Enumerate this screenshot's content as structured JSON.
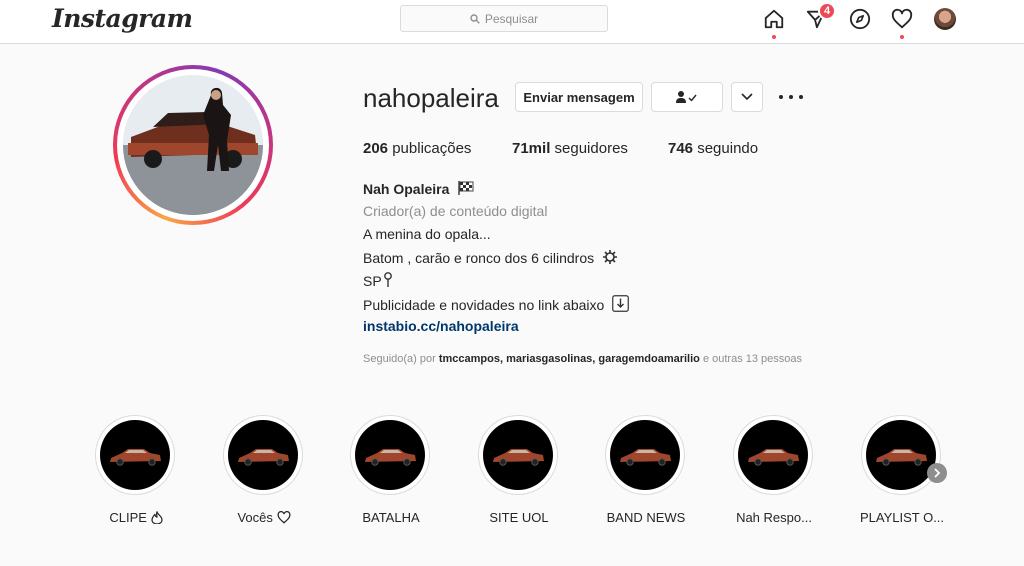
{
  "nav": {
    "logo": "Instagram",
    "search_placeholder": "Pesquisar",
    "notification_count": "4"
  },
  "profile": {
    "username": "nahopaleira",
    "message_button": "Enviar mensagem",
    "stats": {
      "posts_count": "206",
      "posts_label": "publicações",
      "followers_count": "71mil",
      "followers_label": "seguidores",
      "following_count": "746",
      "following_label": "seguindo"
    },
    "bio": {
      "name": "Nah Opaleira",
      "category": "Criador(a) de conteúdo digital",
      "line1": "A menina do opala...",
      "line2": "Batom , carão e ronco dos 6 cilindros",
      "line3": "SP",
      "line4": "Publicidade e novidades no link abaixo",
      "link": "instabio.cc/nahopaleira"
    },
    "followed_by": {
      "prefix": "Seguido(a) por",
      "users": "tmccampos, mariasgasolinas, garagemdoamarilio",
      "suffix": "e outras 13 pessoas"
    }
  },
  "highlights": [
    {
      "label": "CLIPE"
    },
    {
      "label": "Vocês"
    },
    {
      "label": "BATALHA"
    },
    {
      "label": "SITE UOL"
    },
    {
      "label": "BAND NEWS"
    },
    {
      "label": "Nah Respo..."
    },
    {
      "label": "PLAYLIST O..."
    }
  ],
  "colors": {
    "accent_red": "#ed4956",
    "link_blue": "#00376b",
    "car_color": "#a0462c"
  }
}
